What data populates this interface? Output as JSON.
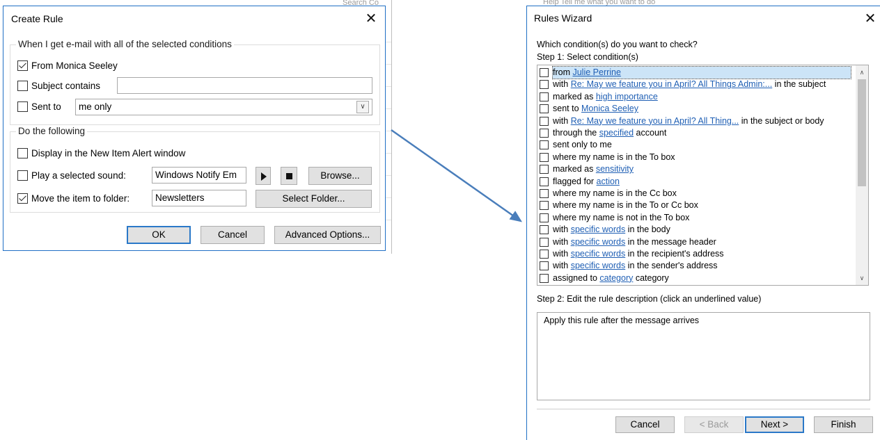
{
  "background": {
    "peek_text_1": "Search Co",
    "peek_text_2": "Help     Tell me what you want to do"
  },
  "create_rule": {
    "title": "Create Rule",
    "conditions_group": "When I get e-mail with all of the selected conditions",
    "from_label": "From Monica Seeley",
    "from_checked": true,
    "subject_label": "Subject contains",
    "subject_value": "",
    "sent_to_label": "Sent to",
    "sent_to_value": "me only",
    "actions_group": "Do the following",
    "display_alert_label": "Display in the New Item Alert window",
    "play_sound_label": "Play a selected sound:",
    "sound_value": "Windows Notify Em",
    "browse_label": "Browse...",
    "move_label": "Move the item to folder:",
    "move_checked": true,
    "folder_value": "Newsletters",
    "select_folder_label": "Select Folder...",
    "ok_label": "OK",
    "cancel_label": "Cancel",
    "advanced_label": "Advanced Options..."
  },
  "rules_wizard": {
    "title": "Rules Wizard",
    "question": "Which condition(s) do you want to check?",
    "step1": "Step 1: Select condition(s)",
    "conditions": [
      {
        "pre": "from ",
        "link": "Julie Perrine",
        "post": ""
      },
      {
        "pre": "with ",
        "link": "Re: May we feature you in April?  All Things Admin:...",
        "post": "  in the subject"
      },
      {
        "pre": "marked as ",
        "link": "high importance",
        "post": ""
      },
      {
        "pre": "sent to ",
        "link": "Monica Seeley",
        "post": ""
      },
      {
        "pre": "with ",
        "link": "Re: May we feature you in April?  All Thing...",
        "post": "   in the subject or body"
      },
      {
        "pre": "through the ",
        "link": "specified",
        "post": " account"
      },
      {
        "pre": "sent only to me",
        "link": "",
        "post": ""
      },
      {
        "pre": "where my name is in the To box",
        "link": "",
        "post": ""
      },
      {
        "pre": "marked as ",
        "link": "sensitivity",
        "post": ""
      },
      {
        "pre": "flagged for ",
        "link": "action",
        "post": ""
      },
      {
        "pre": "where my name is in the Cc box",
        "link": "",
        "post": ""
      },
      {
        "pre": "where my name is in the To or Cc box",
        "link": "",
        "post": ""
      },
      {
        "pre": "where my name is not in the To box",
        "link": "",
        "post": ""
      },
      {
        "pre": "with ",
        "link": "specific words",
        "post": " in the body"
      },
      {
        "pre": "with ",
        "link": "specific words",
        "post": " in the message header"
      },
      {
        "pre": "with ",
        "link": "specific words",
        "post": " in the recipient's address"
      },
      {
        "pre": "with ",
        "link": "specific words",
        "post": " in the sender's address"
      },
      {
        "pre": "assigned to ",
        "link": "category",
        "post": " category"
      }
    ],
    "step2": "Step 2: Edit the rule description (click an underlined value)",
    "description": "Apply this rule after the message arrives",
    "cancel_label": "Cancel",
    "back_label": "< Back",
    "next_label": "Next >",
    "finish_label": "Finish"
  },
  "colors": {
    "accent": "#2a78c8",
    "link": "#1f5fb4",
    "arrow": "#4a7ebb"
  }
}
